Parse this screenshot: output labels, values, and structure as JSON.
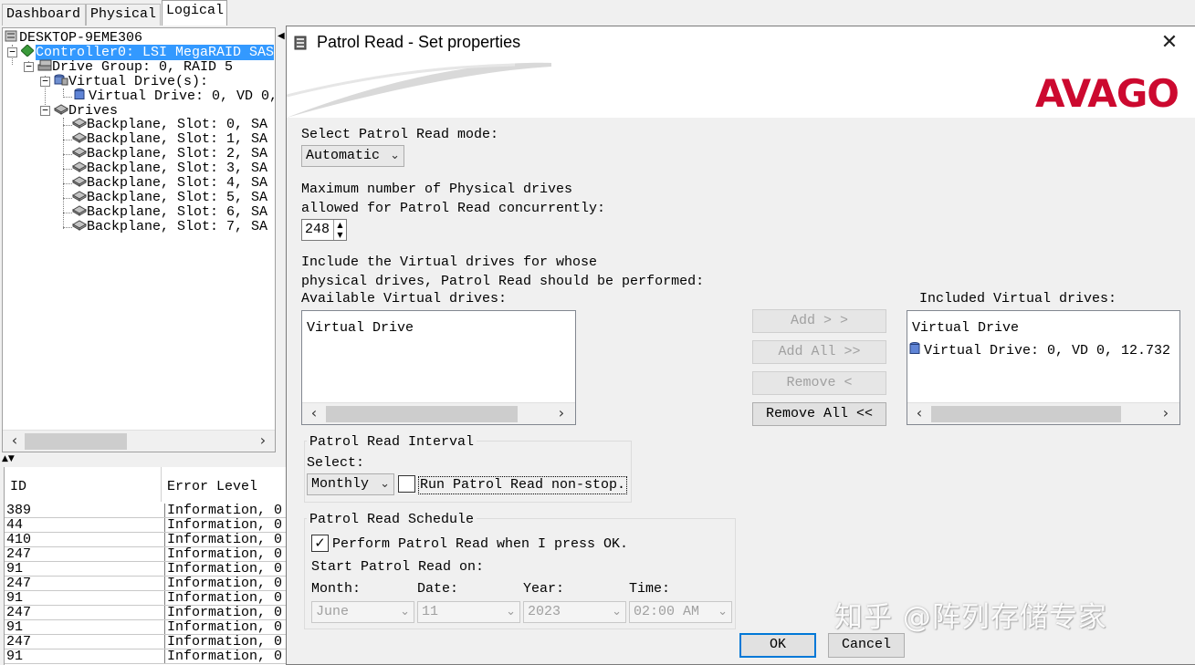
{
  "tabs": [
    "Dashboard",
    "Physical",
    "Logical"
  ],
  "active_tab": "Logical",
  "tree": {
    "host": "DESKTOP-9EME306",
    "controller": "Controller0: LSI MegaRAID SAS",
    "drive_group": "Drive Group: 0, RAID  5",
    "virtual_drives_label": "Virtual Drive(s):",
    "virtual_drive": "Virtual Drive: 0, VD 0,",
    "drives_label": "Drives",
    "drives": [
      "Backplane, Slot: 0, SA",
      "Backplane, Slot: 1, SA",
      "Backplane, Slot: 2, SA",
      "Backplane, Slot: 3, SA",
      "Backplane, Slot: 4, SA",
      "Backplane, Slot: 5, SA",
      "Backplane, Slot: 6, SA",
      "Backplane, Slot: 7, SA"
    ]
  },
  "log": {
    "columns": [
      "ID",
      "Error Level"
    ],
    "rows": [
      {
        "id": "389",
        "level": "Information, 0"
      },
      {
        "id": "44",
        "level": "Information, 0"
      },
      {
        "id": "410",
        "level": "Information, 0"
      },
      {
        "id": "247",
        "level": "Information, 0"
      },
      {
        "id": "91",
        "level": "Information, 0"
      },
      {
        "id": "247",
        "level": "Information, 0"
      },
      {
        "id": "91",
        "level": "Information, 0"
      },
      {
        "id": "247",
        "level": "Information, 0"
      },
      {
        "id": "91",
        "level": "Information, 0"
      },
      {
        "id": "247",
        "level": "Information, 0"
      },
      {
        "id": "91",
        "level": "Information, 0"
      }
    ]
  },
  "dialog": {
    "title": "Patrol Read - Set properties",
    "brand": "AVAGO",
    "brand_color": "#cc092f",
    "mode_label": "Select Patrol Read mode:",
    "mode_value": "Automatic",
    "max_label_1": "Maximum number of Physical drives",
    "max_label_2": "allowed for Patrol Read concurrently:",
    "max_value": "248",
    "include_label_1": "Include the Virtual drives for whose",
    "include_label_2": "physical drives, Patrol Read should be performed:",
    "available_label": "Available Virtual drives:",
    "available_header": "Virtual Drive",
    "included_label": "Included Virtual drives:",
    "included_header": "Virtual Drive",
    "included_items": [
      "Virtual Drive: 0, VD 0, 12.732"
    ],
    "buttons": {
      "add": "Add > >",
      "add_all": "Add All >>",
      "remove": "Remove <",
      "remove_all": "Remove All <<",
      "ok": "OK",
      "cancel": "Cancel"
    },
    "interval": {
      "title": "Patrol Read Interval",
      "select_label": "Select:",
      "value": "Monthly",
      "nonstop_label": "Run Patrol Read non-stop.",
      "nonstop_checked": false
    },
    "schedule": {
      "title": "Patrol Read Schedule",
      "perform_label": "Perform Patrol Read when I press OK.",
      "perform_checked": true,
      "start_label": "Start Patrol Read on:",
      "month_label": "Month:",
      "date_label": "Date:",
      "year_label": "Year:",
      "time_label": "Time:",
      "month": "June",
      "date": "11",
      "year": "2023",
      "time": "02:00 AM"
    }
  },
  "watermark": "知乎 @阵列存储专家"
}
